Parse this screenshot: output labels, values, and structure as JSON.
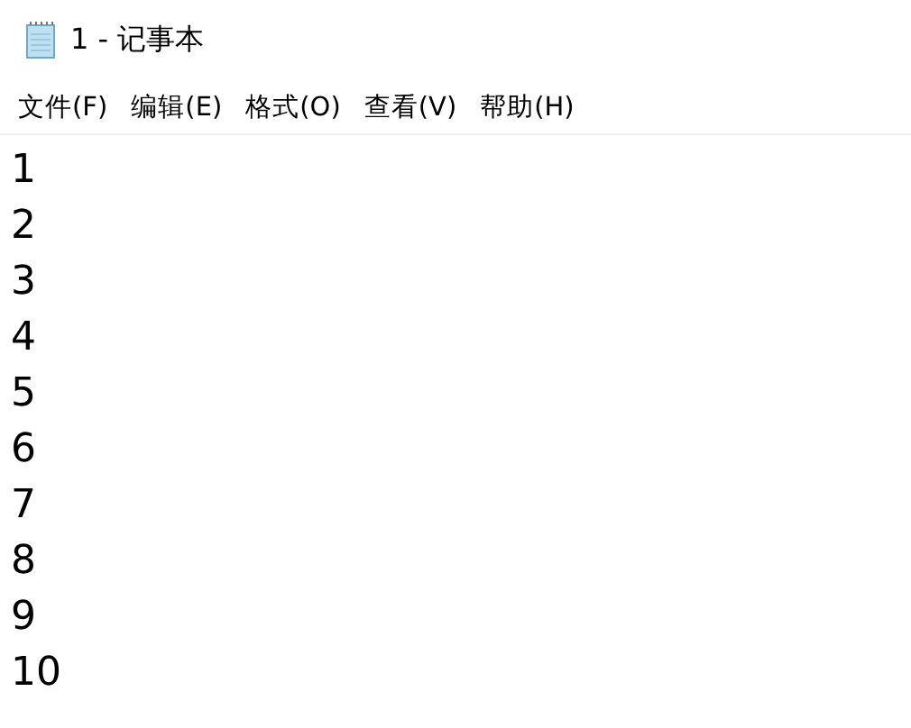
{
  "window": {
    "title": "1 - 记事本"
  },
  "menu": [
    "文件(F)",
    "编辑(E)",
    "格式(O)",
    "查看(V)",
    "帮助(H)"
  ],
  "editor": {
    "lines": [
      "1",
      "2",
      "3",
      "4",
      "5",
      "6",
      "7",
      "8",
      "9",
      "10"
    ]
  }
}
